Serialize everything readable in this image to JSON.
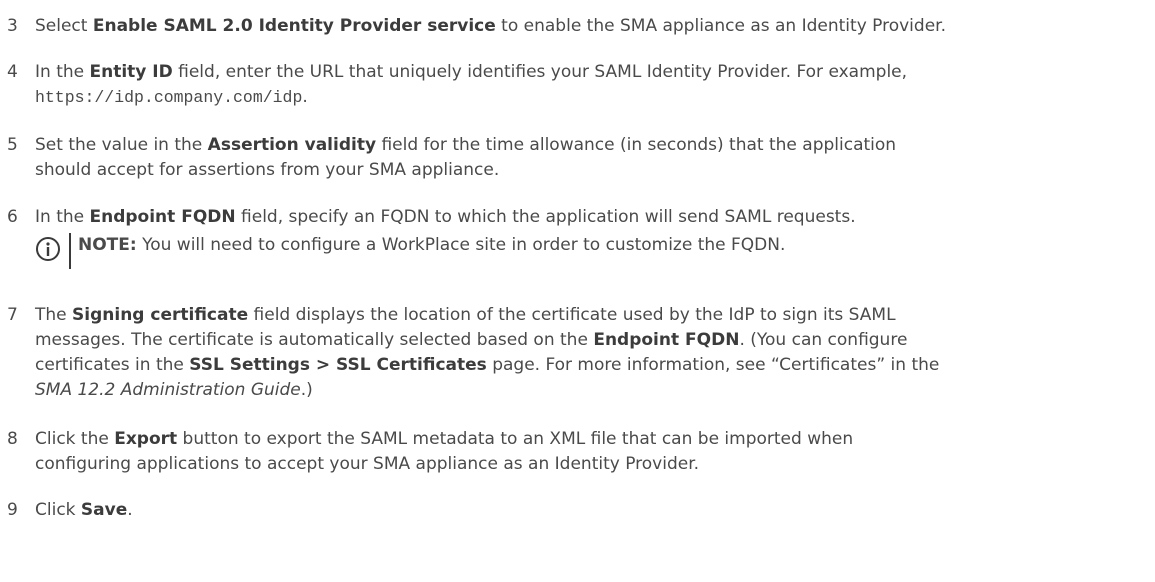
{
  "steps": [
    {
      "num": "3",
      "parts": [
        {
          "t": "Select "
        },
        {
          "t": "Enable SAML 2.0 Identity Provider service",
          "b": true
        },
        {
          "t": " to enable the SMA appliance as an Identity Provider."
        }
      ]
    },
    {
      "num": "4",
      "parts": [
        {
          "t": "In the "
        },
        {
          "t": "Entity ID",
          "b": true
        },
        {
          "t": " field, enter the URL that uniquely identifies your SAML Identity Provider. For example,"
        },
        {
          "br": true
        },
        {
          "t": "https://idp.company.com/idp",
          "m": true
        },
        {
          "t": "."
        }
      ]
    },
    {
      "num": "5",
      "parts": [
        {
          "t": "Set the value in the "
        },
        {
          "t": "Assertion validity",
          "b": true
        },
        {
          "t": " field for the time allowance (in seconds) that the application"
        },
        {
          "br": true
        },
        {
          "t": "should accept for assertions from your SMA appliance."
        }
      ]
    },
    {
      "num": "6",
      "parts": [
        {
          "t": "In the "
        },
        {
          "t": "Endpoint FQDN",
          "b": true
        },
        {
          "t": " field, specify an FQDN to which the application will send SAML requests."
        }
      ]
    },
    {
      "num": "7",
      "parts": [
        {
          "t": "The "
        },
        {
          "t": "Signing certificate",
          "b": true
        },
        {
          "t": " field displays the location of the certificate used by the IdP to sign its SAML"
        },
        {
          "br": true
        },
        {
          "t": "messages. The certificate is automatically selected based on the "
        },
        {
          "t": "Endpoint FQDN",
          "b": true
        },
        {
          "t": ". (You can configure"
        },
        {
          "br": true
        },
        {
          "t": "certificates in the "
        },
        {
          "t": "SSL Settings > SSL Certificates",
          "b": true
        },
        {
          "t": " page. For more information, see “Certificates” in the"
        },
        {
          "br": true
        },
        {
          "t": "SMA 12.2 Administration Guide",
          "i": true
        },
        {
          "t": ".)"
        }
      ]
    },
    {
      "num": "8",
      "parts": [
        {
          "t": "Click the "
        },
        {
          "t": "Export",
          "b": true
        },
        {
          "t": " button to export the SAML metadata to an XML file that can be imported when"
        },
        {
          "br": true
        },
        {
          "t": "configuring applications to accept your SMA appliance as an Identity Provider."
        }
      ]
    },
    {
      "num": "9",
      "parts": [
        {
          "t": "Click "
        },
        {
          "t": "Save",
          "b": true
        },
        {
          "t": "."
        }
      ]
    }
  ],
  "note": {
    "label": "NOTE:",
    "text": " You will need to configure a WorkPlace site in order to customize the FQDN."
  },
  "icons": {
    "note_icon": "info-circle-icon"
  }
}
